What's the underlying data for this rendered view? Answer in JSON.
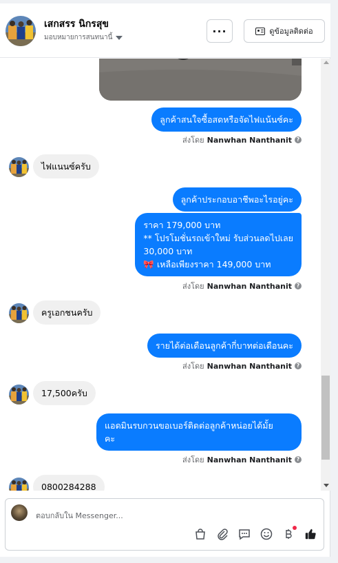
{
  "header": {
    "name": "เสกสรร นิกรสุข",
    "assigned_label": "มอบหมายการสนทนานี้",
    "more_label": "···",
    "contact_button": "ดูข้อมูลติดต่อ"
  },
  "sent_by_prefix": "ส่งโดย",
  "agent_name": "Nanwhan Nanthanit",
  "messages": [
    {
      "dir": "out",
      "text": "ลูกค้าสนใจซื้อสดหรือจัดไฟแน้นซ์คะ"
    },
    {
      "dir": "in",
      "text": "ไฟแนนซ์ครับ"
    },
    {
      "dir": "out",
      "text": "ลูกค้าประกอบอาชีพอะไรอยู่คะ"
    },
    {
      "dir": "out",
      "lines": [
        "ราคา 179,000 บาท",
        "** โปรโมชั่นรถเข้าใหม่ รับส่วนลดไปเลย",
        "30,000 บาท",
        "🎀  เหลือเพียงราคา 149,000 บาท"
      ]
    },
    {
      "dir": "in",
      "text": "ครูเอกชนครับ"
    },
    {
      "dir": "out",
      "text": "รายได้ต่อเดือนลูกค้ากี่บาทต่อเดือนคะ"
    },
    {
      "dir": "in",
      "text": "17,500ครับ"
    },
    {
      "dir": "out",
      "lines": [
        "แอดมินรบกวนขอเบอร์ติดต่อลูกค้าหน่อยได้มั้ย",
        "คะ"
      ]
    },
    {
      "dir": "in",
      "text": "0800284288"
    }
  ],
  "composer": {
    "placeholder": "ตอบกลับใน Messenger..."
  },
  "colors": {
    "outgoing": "#0a7cff",
    "incoming": "#f0f0f0",
    "notification_dot": "#f02849"
  }
}
